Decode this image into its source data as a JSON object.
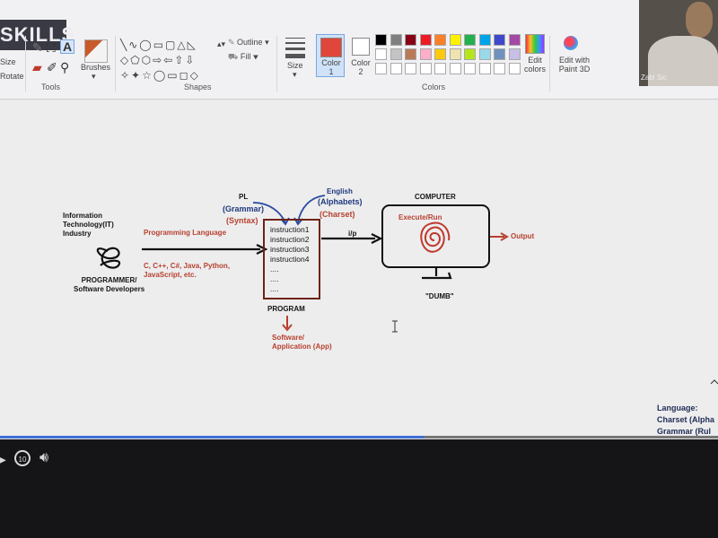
{
  "ribbon": {
    "logo_text": "SKILLS",
    "image_items": [
      "Size",
      "Rotate"
    ],
    "tools_label": "Tools",
    "brushes_label": "Brushes",
    "shapes_label": "Shapes",
    "outline_label": "Outline",
    "fill_label": "Fill",
    "size_label": "Size",
    "color1_label": "Color\n1",
    "color2_label": "Color\n2",
    "colors_label": "Colors",
    "edit_colors_label": "Edit\ncolors",
    "paint3d_label": "Edit with\nPaint 3D",
    "color1_value": "#e0463b",
    "color2_value": "#ffffff",
    "palette_row1": [
      "#000000",
      "#7f7f7f",
      "#880015",
      "#ed1c24",
      "#ff7f27",
      "#fff200",
      "#22b14c",
      "#00a2e8",
      "#3f48cc",
      "#a349a4"
    ],
    "palette_row2": [
      "#ffffff",
      "#c3c3c3",
      "#b97a57",
      "#ffaec9",
      "#ffc90e",
      "#efe4b0",
      "#b5e61d",
      "#99d9ea",
      "#7092be",
      "#c8bfe7"
    ],
    "palette_row3": [
      "#ffffff",
      "#ffffff",
      "#ffffff",
      "#ffffff",
      "#ffffff",
      "#ffffff",
      "#ffffff",
      "#ffffff",
      "#ffffff",
      "#ffffff"
    ]
  },
  "webcam": {
    "name_label": "Zabi Sic"
  },
  "diagram": {
    "industry_label": "Information\nTechnology(IT)\nIndustry",
    "programmer_label": "PROGRAMMER/\nSoftware Developers",
    "pl_arrow_label": "Programming Language",
    "languages_label": "C, C++, C#, Java, Python,\nJavaScript, etc.",
    "pl_label": "PL",
    "grammar_label": "(Grammar)",
    "syntax_label": "(Syntax)",
    "english_label": "English",
    "alphabets_label": "(Alphabets)",
    "charset_label": "(Charset)",
    "instructions": [
      "instruction1",
      "instruction2",
      "instruction3",
      "instruction4",
      "....",
      "....",
      "...."
    ],
    "program_label": "PROGRAM",
    "software_label": "Software/\nApplication (App)",
    "ip_label": "i/p",
    "computer_label": "COMPUTER",
    "execute_label": "Execute/Run",
    "output_label": "Output",
    "dumb_label": "\"DUMB\"",
    "language_title": "Language:",
    "charset_note": "Charset (Alpha",
    "grammar_note": "Grammar (Rul"
  },
  "player": {
    "skip_label": "10",
    "progress": 0.59
  }
}
